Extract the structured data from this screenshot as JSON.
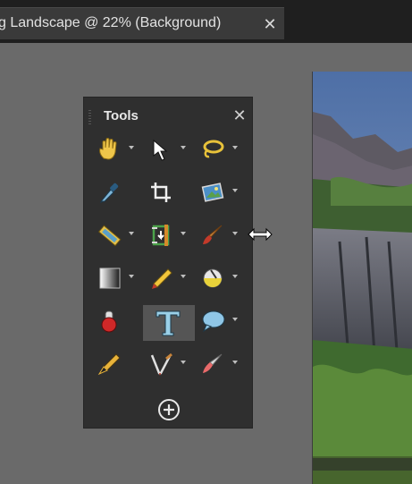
{
  "tab": {
    "title": "g Landscape @  22% (Background)",
    "close_symbol": "✕"
  },
  "tools_panel": {
    "title": "Tools",
    "close_symbol": "✕",
    "tools": [
      {
        "name": "pan-tool",
        "icon": "hand-icon",
        "has_submenu": true
      },
      {
        "name": "select-tool",
        "icon": "arrow-pointer-icon",
        "has_submenu": true
      },
      {
        "name": "lasso-tool",
        "icon": "lasso-icon",
        "has_submenu": true
      },
      {
        "name": "eyedropper-tool",
        "icon": "eyedropper-icon",
        "has_submenu": false
      },
      {
        "name": "crop-tool",
        "icon": "crop-icon",
        "has_submenu": false
      },
      {
        "name": "picture-tool",
        "icon": "picture-icon",
        "has_submenu": true
      },
      {
        "name": "ruler-tool",
        "icon": "ruler-icon",
        "has_submenu": true
      },
      {
        "name": "straighten-tool",
        "icon": "straighten-icon",
        "has_submenu": true
      },
      {
        "name": "paint-brush-tool",
        "icon": "paint-brush-icon",
        "has_submenu": true
      },
      {
        "name": "gradient-tool",
        "icon": "gradient-icon",
        "has_submenu": true
      },
      {
        "name": "eraser-pencil-tool",
        "icon": "pencil-icon",
        "has_submenu": true
      },
      {
        "name": "fill-tool",
        "icon": "paint-bucket-icon",
        "has_submenu": true
      },
      {
        "name": "stamp-tool",
        "icon": "stamp-icon",
        "has_submenu": false
      },
      {
        "name": "text-tool",
        "icon": "text-t-icon",
        "label": "T",
        "selected": true,
        "has_submenu": false
      },
      {
        "name": "speech-bubble-tool",
        "icon": "speech-bubble-icon",
        "has_submenu": true
      },
      {
        "name": "pen-tool",
        "icon": "pen-nib-icon",
        "has_submenu": false
      },
      {
        "name": "brush-effects-tool",
        "icon": "brush-tweezers-icon",
        "has_submenu": true
      },
      {
        "name": "retouch-brush-tool",
        "icon": "retouch-brush-icon",
        "has_submenu": true
      }
    ],
    "add_tool": "plus-circle-icon"
  },
  "colors": {
    "accent_yellow": "#e8c23a",
    "panel_bg": "#2f2f2f",
    "selected_bg": "#555555"
  }
}
